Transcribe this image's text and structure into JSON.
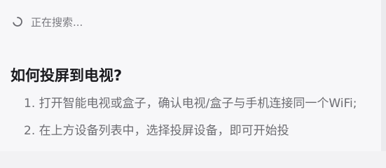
{
  "search": {
    "status_text": "正在搜索..."
  },
  "help": {
    "title": "如何投屏到电视?",
    "steps": [
      {
        "text": "1. 打开智能电视或盒子，确认电视/盒子与手机连接同一个WiFi;"
      },
      {
        "text": "2. 在上方设备列表中，选择投屏设备，即可开始投"
      }
    ]
  },
  "colors": {
    "background": "#f7f7f9",
    "heading": "#1a1a1e",
    "step_text": "#6d6d72",
    "status_text": "#7a7a80"
  },
  "icons": {
    "status": "spinner-icon"
  }
}
